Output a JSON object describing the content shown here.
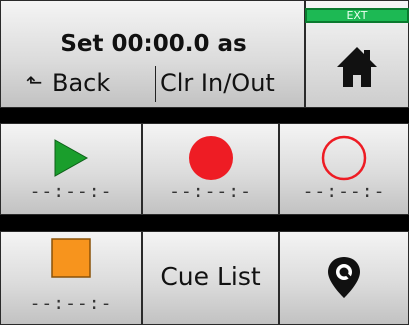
{
  "header": {
    "title": "Set 00:00.0 as",
    "back_label": "Back",
    "clear_label": "Clr In/Out",
    "ext_badge": "EXT"
  },
  "buttons": {
    "play": {
      "timecode": "--:--:-"
    },
    "record": {
      "timecode": "--:--:-"
    },
    "record_ready": {
      "timecode": "--:--:-"
    },
    "stop": {
      "timecode": "--:--:-"
    },
    "cue_list": {
      "label": "Cue List"
    }
  },
  "icons": {
    "home": "home-icon",
    "play": "play-icon",
    "record": "record-icon",
    "record_ready": "record-outline-icon",
    "stop": "stop-icon",
    "cue_marker": "q-marker-icon",
    "back": "back-arrow-icon"
  },
  "colors": {
    "play": "#1a9e2c",
    "record": "#ee1c24",
    "record_outline": "#ee1c24",
    "stop": "#f7941d",
    "ext_badge": "#1db954"
  }
}
